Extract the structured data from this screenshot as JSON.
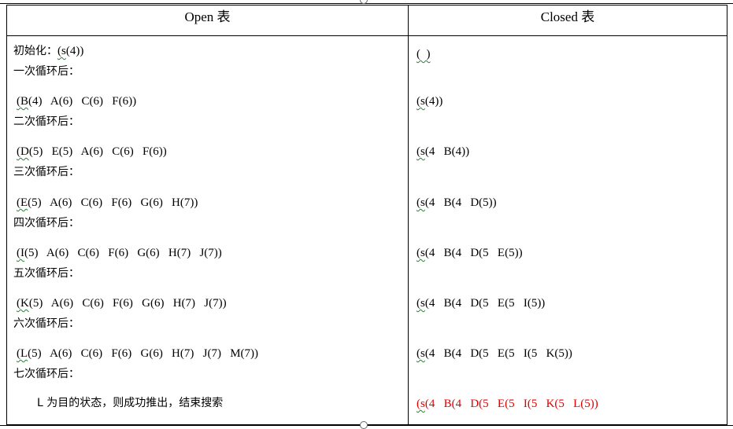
{
  "headers": {
    "open": "Open 表",
    "closed": "Closed 表"
  },
  "open_rows": [
    {
      "label": "初始化：",
      "wave": "(s",
      "rest": "(4))"
    },
    {
      "label": "一次循环后："
    },
    {
      "wave": "(B",
      "rest": "(4)   A(6)   C(6)   F(6))"
    },
    {
      "label": "二次循环后："
    },
    {
      "wave": "(D",
      "rest": "(5)   E(5)   A(6)   C(6)   F(6))"
    },
    {
      "label": "三次循环后："
    },
    {
      "wave": "(E",
      "rest": "(5)   A(6)   C(6)   F(6)   G(6)   H(7))"
    },
    {
      "label": "四次循环后："
    },
    {
      "wave": "(I",
      "rest": "(5)   A(6)   C(6)   F(6)   G(6)   H(7)   J(7))"
    },
    {
      "label": "五次循环后："
    },
    {
      "wave": "(K",
      "rest": "(5)   A(6)   C(6)   F(6)   G(6)   H(7)   J(7))"
    },
    {
      "label": "六次循环后："
    },
    {
      "wave": "(L",
      "rest": "(5)   A(6)   C(6)   F(6)   G(6)   H(7)   J(7)   M(7))"
    },
    {
      "label": "七次循环后："
    }
  ],
  "final_statement": "L 为目的状态，则成功推出，结束搜索",
  "closed_rows": [
    {
      "wave": "(  )",
      "rest": ""
    },
    {
      "wave": "(s",
      "rest": "(4))"
    },
    {
      "wave": "(s",
      "rest": "(4   B(4))"
    },
    {
      "wave": "(s",
      "rest": "(4   B(4   D(5))"
    },
    {
      "wave": "(s",
      "rest": "(4   B(4   D(5   E(5))"
    },
    {
      "wave": "(s",
      "rest": "(4   B(4   D(5   E(5   I(5))"
    },
    {
      "wave": "(s",
      "rest": "(4   B(4   D(5   E(5   I(5   K(5))"
    },
    {
      "wave": "(s",
      "rest": "(4   B(4   D(5   E(5   I(5   K(5   L(5))"
    }
  ],
  "colors": {
    "text": "#000000",
    "highlight": "#e00000",
    "spell_underline": "#2e7d32"
  }
}
